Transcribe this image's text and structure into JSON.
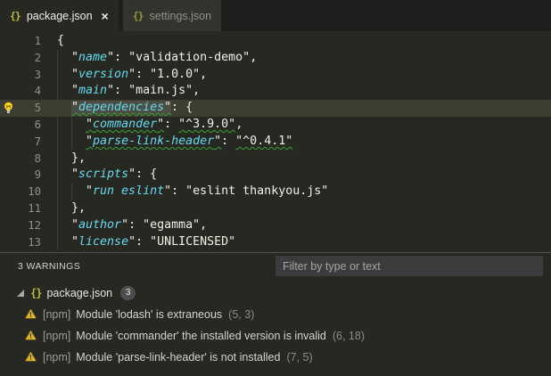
{
  "tabs": {
    "items": [
      {
        "label": "package.json",
        "icon": "{}",
        "close_label": "×",
        "active": true
      },
      {
        "label": "settings.json",
        "icon": "{}",
        "active": false
      }
    ]
  },
  "editor": {
    "language": "json",
    "lines": [
      {
        "num": "1",
        "guides": [],
        "tokens": [
          {
            "c": "p",
            "t": "{"
          }
        ]
      },
      {
        "num": "2",
        "guides": [
          0
        ],
        "tokens": [
          {
            "c": "p",
            "t": "  \""
          },
          {
            "c": "k",
            "t": "name"
          },
          {
            "c": "p",
            "t": "\": "
          },
          {
            "c": "s",
            "t": "\"validation-demo\""
          },
          {
            "c": "p",
            "t": ","
          }
        ]
      },
      {
        "num": "3",
        "guides": [
          0
        ],
        "tokens": [
          {
            "c": "p",
            "t": "  \""
          },
          {
            "c": "k",
            "t": "version"
          },
          {
            "c": "p",
            "t": "\": "
          },
          {
            "c": "s",
            "t": "\"1.0.0\""
          },
          {
            "c": "p",
            "t": ","
          }
        ]
      },
      {
        "num": "4",
        "guides": [
          0
        ],
        "tokens": [
          {
            "c": "p",
            "t": "  \""
          },
          {
            "c": "k",
            "t": "main"
          },
          {
            "c": "p",
            "t": "\": "
          },
          {
            "c": "s",
            "t": "\"main.js\""
          },
          {
            "c": "p",
            "t": ","
          }
        ]
      },
      {
        "num": "5",
        "guides": [
          0
        ],
        "current": true,
        "lightbulb": true,
        "tokens": [
          {
            "c": "p",
            "t": "  "
          },
          {
            "c": "p",
            "t": "\"",
            "sq": 1,
            "hl": 1
          },
          {
            "c": "k",
            "t": "dependencies",
            "sq": 1,
            "hl": 1
          },
          {
            "c": "p",
            "t": "\"",
            "sq": 1,
            "hl": 1
          },
          {
            "c": "p",
            "t": ": {"
          }
        ]
      },
      {
        "num": "6",
        "guides": [
          0,
          1
        ],
        "tokens": [
          {
            "c": "p",
            "t": "    "
          },
          {
            "c": "p",
            "t": "\"",
            "sq": 1
          },
          {
            "c": "k",
            "t": "commander",
            "sq": 1
          },
          {
            "c": "p",
            "t": "\"",
            "sq": 1
          },
          {
            "c": "p",
            "t": ": "
          },
          {
            "c": "s",
            "t": "\"^3.9.0\"",
            "sq": 1
          },
          {
            "c": "p",
            "t": ","
          }
        ]
      },
      {
        "num": "7",
        "guides": [
          0,
          1
        ],
        "tokens": [
          {
            "c": "p",
            "t": "    "
          },
          {
            "c": "p",
            "t": "\"",
            "sq": 1
          },
          {
            "c": "k",
            "t": "parse-link-header",
            "sq": 1
          },
          {
            "c": "p",
            "t": "\"",
            "sq": 1
          },
          {
            "c": "p",
            "t": ": "
          },
          {
            "c": "s",
            "t": "\"^0.4.1\"",
            "sq": 1
          }
        ]
      },
      {
        "num": "8",
        "guides": [
          0
        ],
        "tokens": [
          {
            "c": "p",
            "t": "  },"
          }
        ]
      },
      {
        "num": "9",
        "guides": [
          0
        ],
        "tokens": [
          {
            "c": "p",
            "t": "  \""
          },
          {
            "c": "k",
            "t": "scripts"
          },
          {
            "c": "p",
            "t": "\": {"
          }
        ]
      },
      {
        "num": "10",
        "guides": [
          0,
          1
        ],
        "tokens": [
          {
            "c": "p",
            "t": "    \""
          },
          {
            "c": "k",
            "t": "run eslint"
          },
          {
            "c": "p",
            "t": "\": "
          },
          {
            "c": "s",
            "t": "\"eslint thankyou.js\""
          }
        ]
      },
      {
        "num": "11",
        "guides": [
          0
        ],
        "tokens": [
          {
            "c": "p",
            "t": "  },"
          }
        ]
      },
      {
        "num": "12",
        "guides": [
          0
        ],
        "tokens": [
          {
            "c": "p",
            "t": "  \""
          },
          {
            "c": "k",
            "t": "author"
          },
          {
            "c": "p",
            "t": "\": "
          },
          {
            "c": "s",
            "t": "\"egamma\""
          },
          {
            "c": "p",
            "t": ","
          }
        ]
      },
      {
        "num": "13",
        "guides": [
          0
        ],
        "tokens": [
          {
            "c": "p",
            "t": "  \""
          },
          {
            "c": "k",
            "t": "license"
          },
          {
            "c": "p",
            "t": "\": "
          },
          {
            "c": "s",
            "t": "\"UNLICENSED\""
          }
        ]
      }
    ]
  },
  "panel": {
    "header": {
      "title": "3 WARNINGS",
      "filter_placeholder": "Filter by type or text",
      "filter_value": ""
    },
    "tree": {
      "file": {
        "icon": "{}",
        "label": "package.json",
        "badge": "3"
      },
      "warnings": [
        {
          "source": "[npm]",
          "message": "Module 'lodash' is extraneous",
          "location": "(5, 3)"
        },
        {
          "source": "[npm]",
          "message": "Module 'commander' the installed version is invalid",
          "location": "(6, 18)"
        },
        {
          "source": "[npm]",
          "message": "Module 'parse-link-header' is not installed",
          "location": "(7, 5)"
        }
      ]
    }
  },
  "colors": {
    "editor_bg": "#272822",
    "tabbar_bg": "#1e1f1c",
    "inactive_tab_bg": "#33342e",
    "current_line": "#3e3d32",
    "key_cyan": "#66d9ef",
    "code_fg": "#f1f1ea",
    "squiggle_green": "#3ba33b",
    "json_icon_yellow": "#b8b93f",
    "warning_yellow": "#ddb62a",
    "badge_bg": "#4d4d4d",
    "line_number": "#90908a"
  }
}
